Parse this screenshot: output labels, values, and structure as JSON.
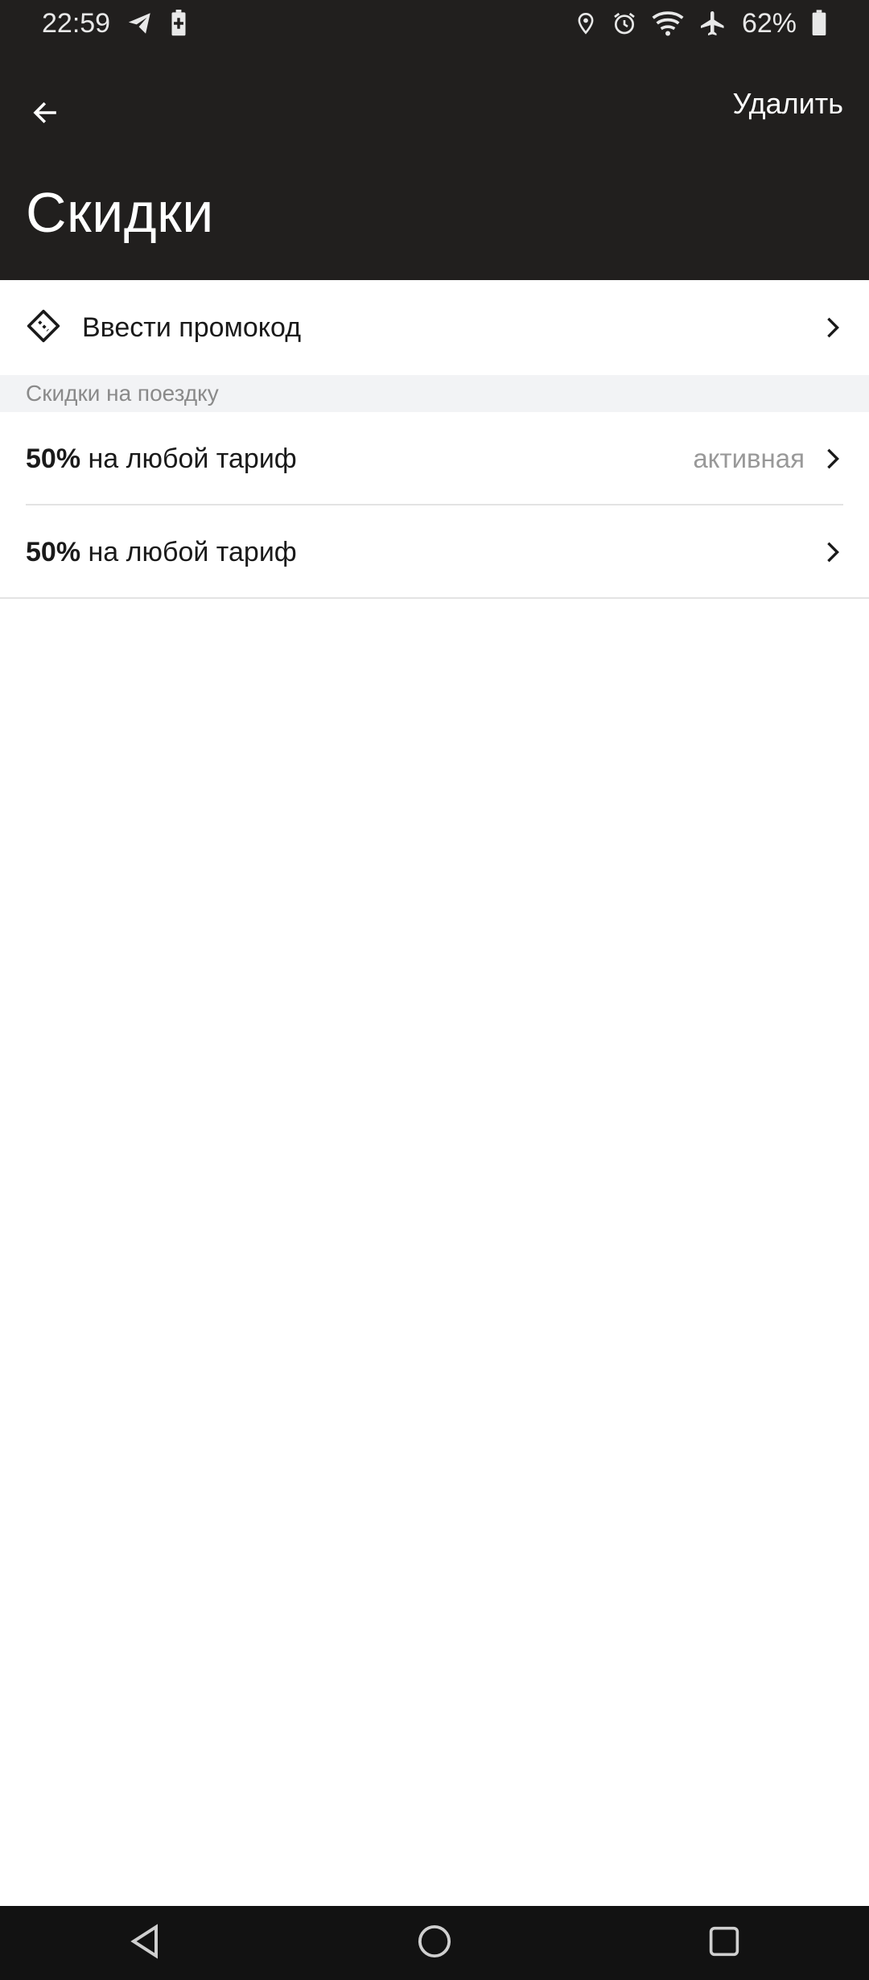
{
  "status_bar": {
    "time": "22:59",
    "battery": "62%",
    "left_icons": [
      "telegram-icon",
      "battery-saver-icon"
    ],
    "right_icons": [
      "location-icon",
      "alarm-icon",
      "wifi-icon",
      "airplane-icon",
      "battery-icon"
    ]
  },
  "appbar": {
    "back_icon": "arrow-left-icon",
    "delete_label": "Удалить",
    "title": "Скидки"
  },
  "promo": {
    "icon": "ticket-icon",
    "label": "Ввести промокод"
  },
  "section": {
    "title": "Скидки на поездку"
  },
  "discounts": [
    {
      "percent": "50%",
      "description": "на любой тариф",
      "status": "активная"
    },
    {
      "percent": "50%",
      "description": "на любой тариф",
      "status": ""
    }
  ],
  "nav": {
    "icons": [
      "back-triangle-icon",
      "home-circle-icon",
      "recents-square-icon"
    ]
  },
  "colors": {
    "header_bg": "#211f1e",
    "section_bg": "#f2f3f5",
    "nav_bg": "#121212"
  }
}
